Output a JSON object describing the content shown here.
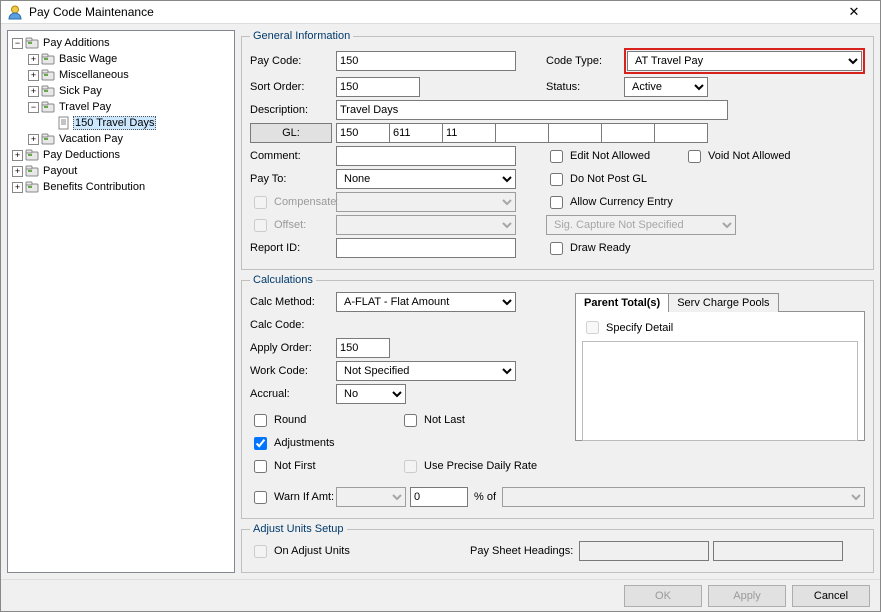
{
  "window": {
    "title": "Pay Code Maintenance"
  },
  "tree": {
    "root": [
      {
        "label": "Pay Additions",
        "exp": true,
        "kind": "folder",
        "children": [
          {
            "label": "Basic Wage",
            "exp": false,
            "kind": "folder"
          },
          {
            "label": "Miscellaneous",
            "exp": false,
            "kind": "folder"
          },
          {
            "label": "Sick Pay",
            "exp": false,
            "kind": "folder"
          },
          {
            "label": "Travel Pay",
            "exp": true,
            "kind": "folder",
            "children": [
              {
                "label": "150 Travel Days",
                "kind": "leaf",
                "selected": true
              }
            ]
          },
          {
            "label": "Vacation Pay",
            "exp": false,
            "kind": "folder"
          }
        ]
      },
      {
        "label": "Pay Deductions",
        "exp": false,
        "kind": "folder"
      },
      {
        "label": "Payout",
        "exp": false,
        "kind": "folder"
      },
      {
        "label": "Benefits Contribution",
        "exp": false,
        "kind": "folder"
      }
    ]
  },
  "general": {
    "legend": "General Information",
    "payCodeLabel": "Pay Code:",
    "payCode": "150",
    "codeTypeLabel": "Code Type:",
    "codeType": "AT Travel Pay",
    "sortOrderLabel": "Sort Order:",
    "sortOrder": "150",
    "statusLabel": "Status:",
    "status": "Active",
    "descriptionLabel": "Description:",
    "description": "Travel Days",
    "glLabel": "GL:",
    "gl": [
      "150",
      "611",
      "11",
      "",
      "",
      "",
      ""
    ],
    "commentLabel": "Comment:",
    "comment": "",
    "editNotAllowed": "Edit Not Allowed",
    "voidNotAllowed": "Void Not Allowed",
    "payToLabel": "Pay To:",
    "payTo": "None",
    "doNotPostGL": "Do Not Post GL",
    "compensateLabel": "Compensate:",
    "allowCurrency": "Allow Currency Entry",
    "offsetLabel": "Offset:",
    "sigCapture": "Sig. Capture Not Specified",
    "reportIdLabel": "Report ID:",
    "reportId": "",
    "drawReady": "Draw Ready"
  },
  "calc": {
    "legend": "Calculations",
    "calcMethodLabel": "Calc Method:",
    "calcMethod": "A-FLAT - Flat Amount",
    "calcCodeLabel": "Calc Code:",
    "applyOrderLabel": "Apply Order:",
    "applyOrder": "150",
    "workCodeLabel": "Work Code:",
    "workCode": "Not Specified",
    "accrualLabel": "Accrual:",
    "accrual": "No",
    "round": "Round",
    "notLast": "Not Last",
    "adjustments": "Adjustments",
    "notFirst": "Not First",
    "usePrecise": "Use Precise Daily Rate",
    "tabParent": "Parent Total(s)",
    "tabServ": "Serv Charge Pools",
    "specifyDetail": "Specify Detail",
    "warnIfAmt": "Warn If Amt:",
    "warnVal": "0",
    "percentOf": "% of"
  },
  "adjust": {
    "legend": "Adjust Units Setup",
    "onAdjust": "On Adjust Units",
    "paySheet": "Pay Sheet Headings:"
  },
  "buttons": {
    "ok": "OK",
    "apply": "Apply",
    "cancel": "Cancel"
  }
}
